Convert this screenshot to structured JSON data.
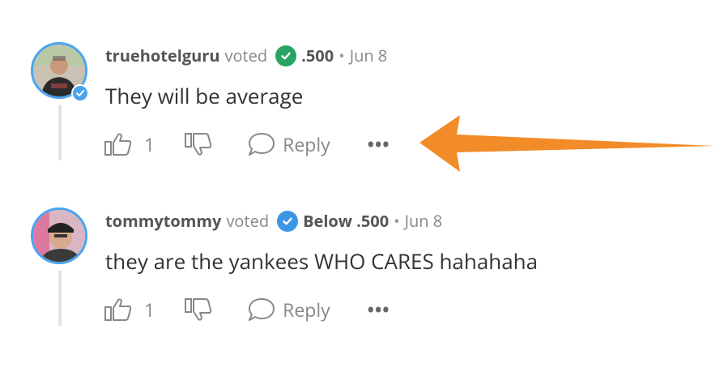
{
  "comments": [
    {
      "username": "truehotelguru",
      "voted_text": "voted",
      "choice": ".500",
      "separator": "•",
      "date": "Jun 8",
      "body": "They will be average",
      "likes": "1",
      "reply_label": "Reply",
      "more_label": "•••",
      "badge_color": "#28a464"
    },
    {
      "username": "tommytommy",
      "voted_text": "voted",
      "choice": "Below .500",
      "separator": "•",
      "date": "Jun 8",
      "body": "they are the yankees WHO CARES hahahaha",
      "likes": "1",
      "reply_label": "Reply",
      "more_label": "•••",
      "badge_color": "#3c96e6"
    }
  ],
  "colors": {
    "avatar_ring": "#4aa3f0",
    "annotation_arrow": "#f28c28",
    "thread_line": "#e3e3e3"
  }
}
